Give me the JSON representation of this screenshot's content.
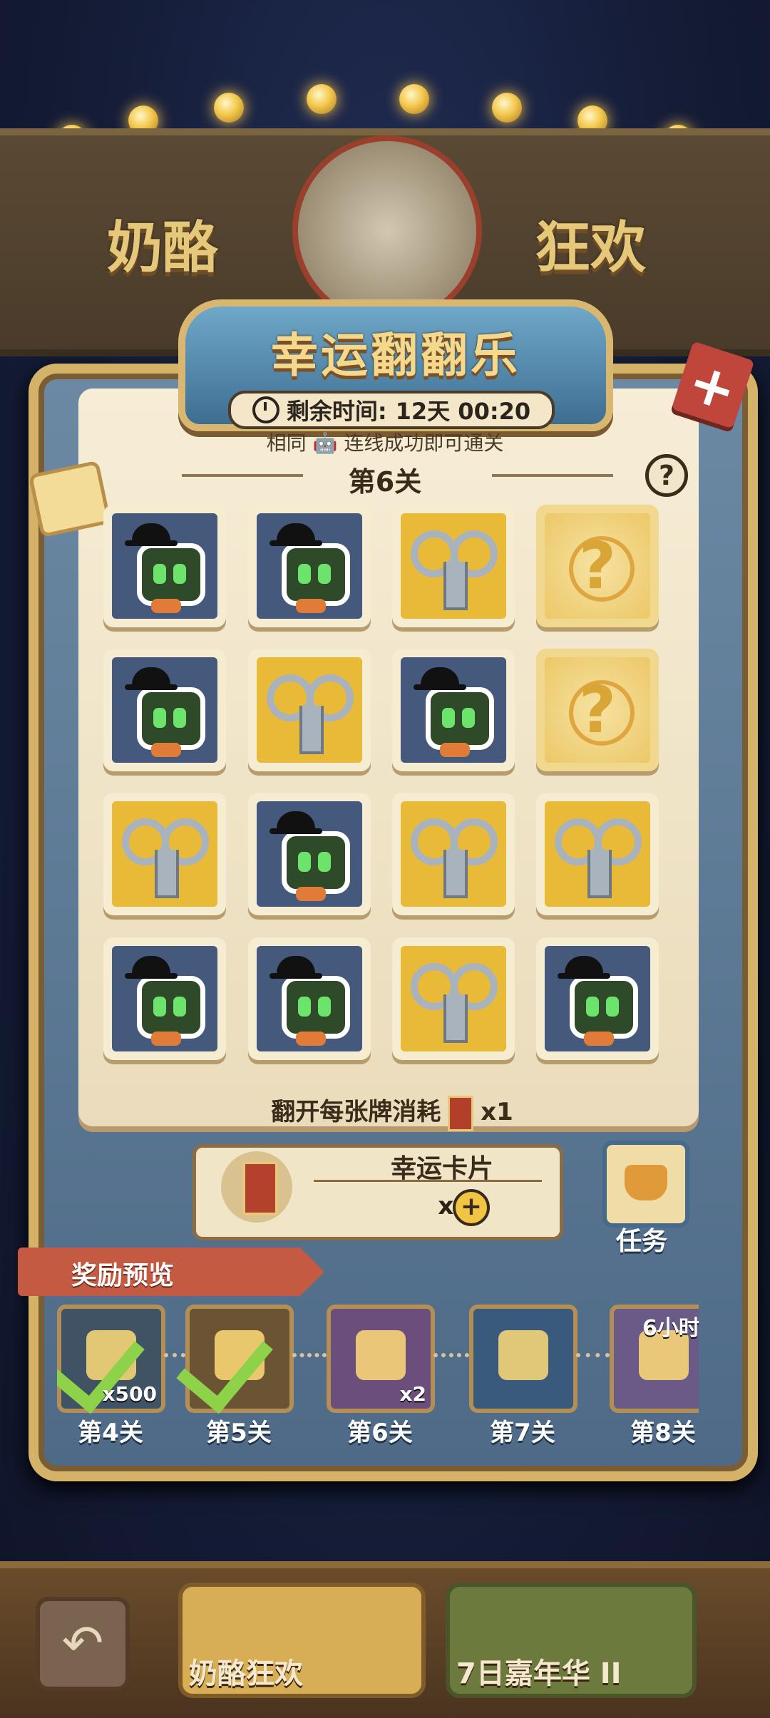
{
  "header": {
    "left_word": "奶酪",
    "right_word": "狂欢"
  },
  "banner": {
    "title": "幸运翻翻乐"
  },
  "timer": {
    "label": "剩余时间:",
    "value": "12天 00:20"
  },
  "hint": "相同 🤖 连线成功即可通关",
  "level": "第6关",
  "help_glyph": "?",
  "close_glyph": "+",
  "cards": [
    [
      "robot",
      "robot",
      "key",
      "question"
    ],
    [
      "robot",
      "key",
      "robot",
      "question"
    ],
    [
      "key",
      "robot",
      "key",
      "key"
    ],
    [
      "robot",
      "robot",
      "key",
      "robot"
    ]
  ],
  "cost": {
    "text": "翻开每张牌消耗",
    "qty": "x1"
  },
  "lucky_card": {
    "name": "幸运卡片",
    "count": "x0",
    "plus": "+"
  },
  "task": {
    "label": "任务"
  },
  "rewards": {
    "title": "奖励预览",
    "items": [
      {
        "label": "第4关",
        "qty": "x500",
        "claimed": true,
        "icon": "cheese-icon"
      },
      {
        "label": "第5关",
        "qty": "",
        "claimed": true,
        "icon": "ticket-icon"
      },
      {
        "label": "第6关",
        "qty": "x2",
        "claimed": false,
        "icon": "candy-pack-icon"
      },
      {
        "label": "第7关",
        "qty": "",
        "claimed": false,
        "icon": "gift-cube-icon"
      },
      {
        "label": "第8关",
        "qty": "",
        "claimed": false,
        "icon": "mystery-scroll-icon",
        "timer": "6小时"
      }
    ]
  },
  "bottom_nav": {
    "back": "↶",
    "tab1": "奶酪狂欢",
    "tab2": "7日嘉年华 II"
  },
  "colors": {
    "board_border": "#d4b268",
    "robot_bg": "#44597c",
    "key_bg": "#e9b938",
    "accent_red": "#c55a42"
  }
}
